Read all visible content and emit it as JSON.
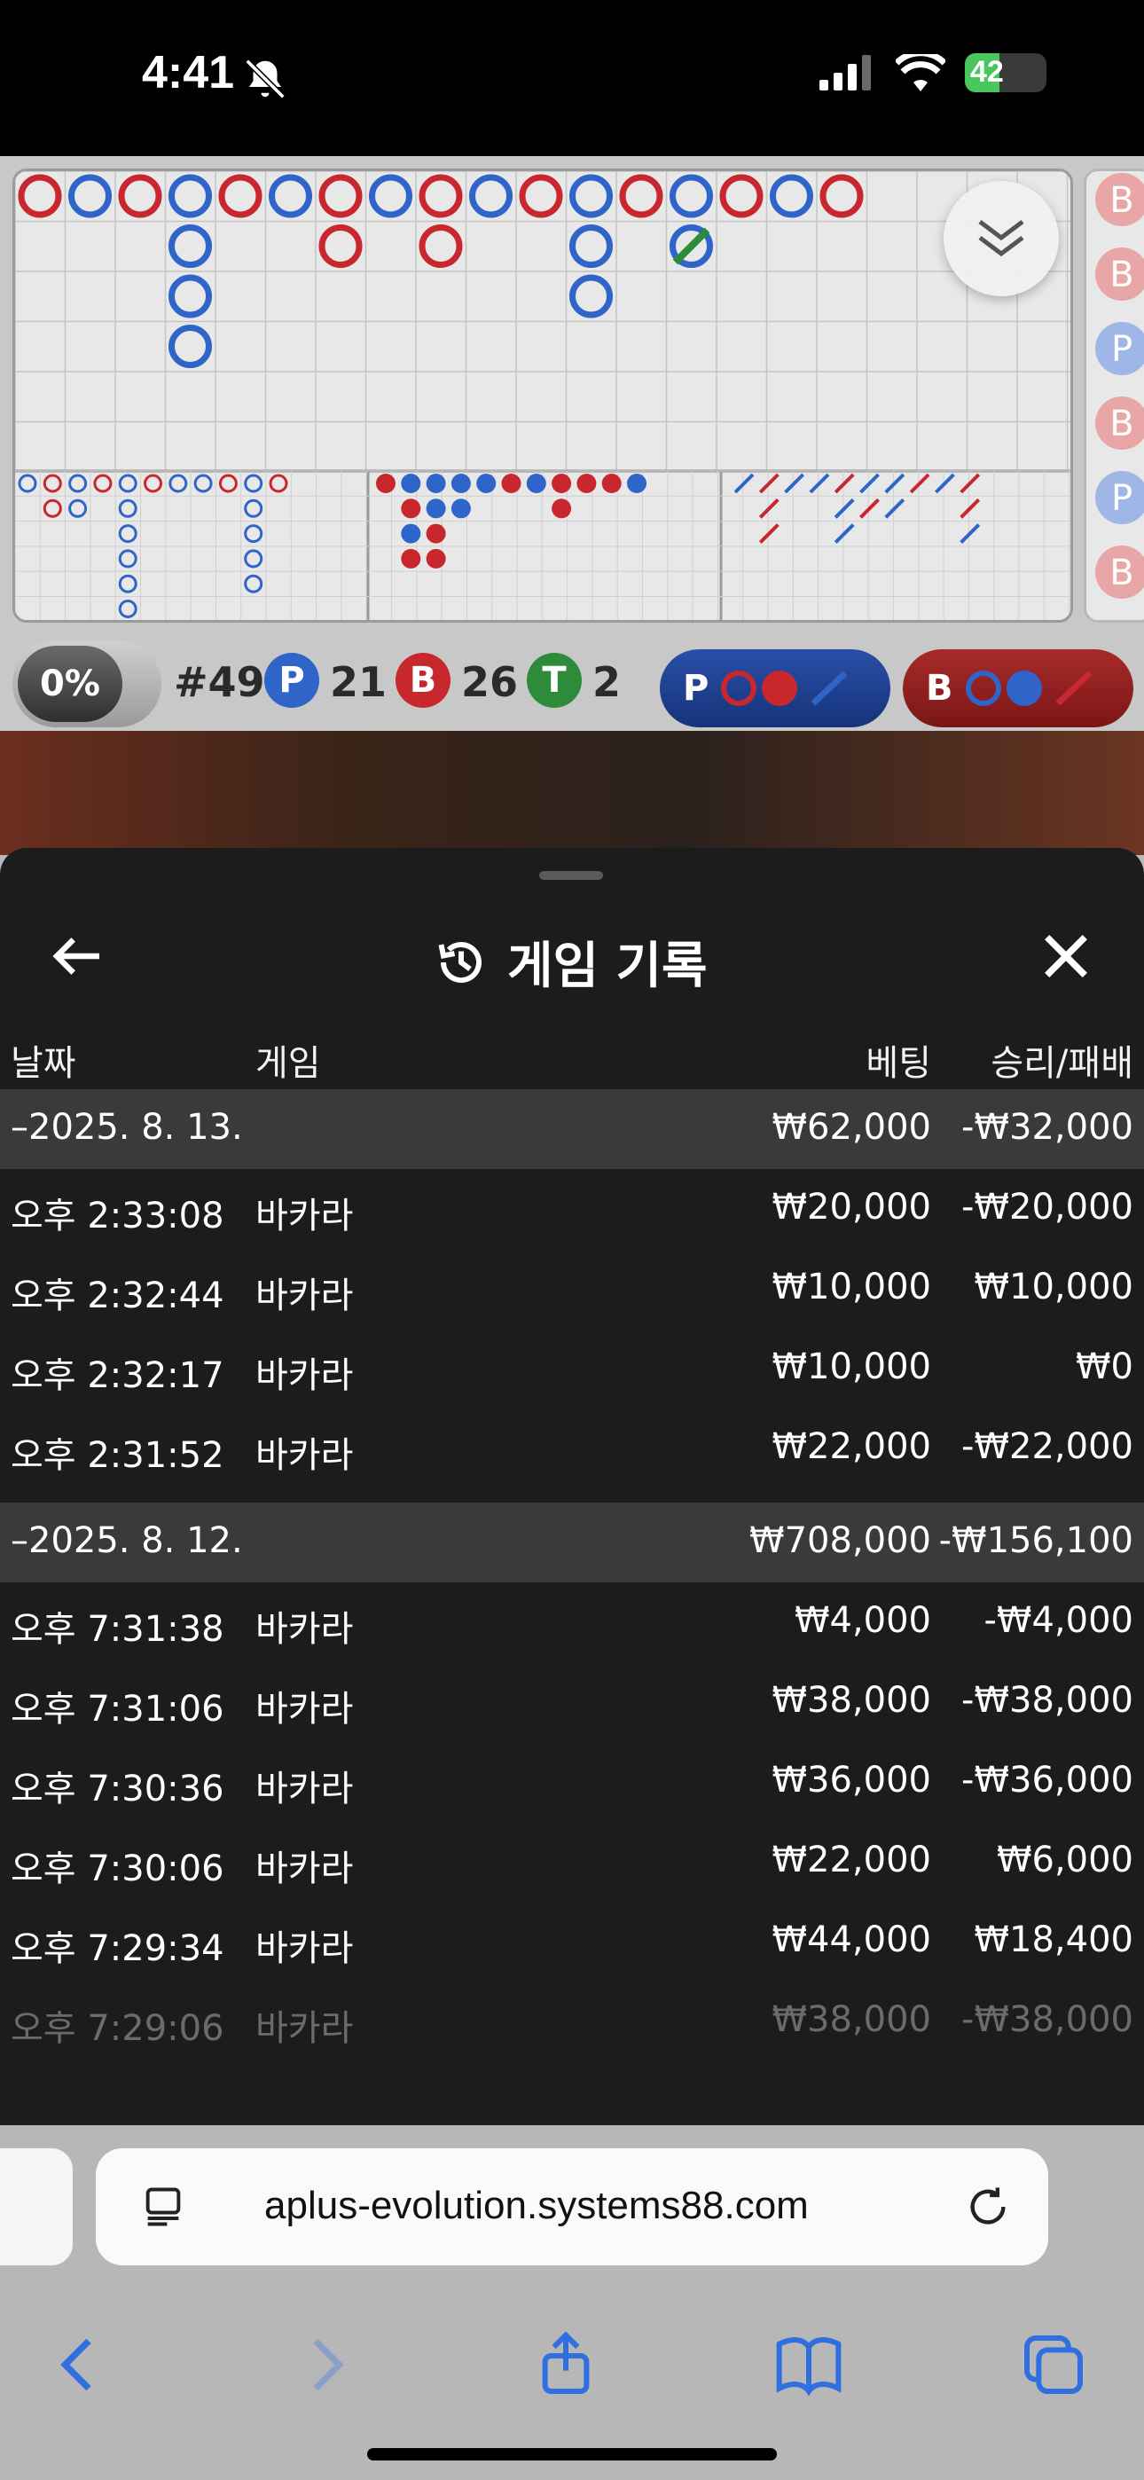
{
  "status_bar": {
    "time": "4:41",
    "battery": "42"
  },
  "roadmap": {
    "stats": {
      "percent": "0%",
      "round": "#49",
      "player_label": "P",
      "player_count": "21",
      "banker_label": "B",
      "banker_count": "26",
      "tie_label": "T",
      "tie_count": "2"
    },
    "predict_player_label": "P",
    "predict_banker_label": "B",
    "side_labels": [
      "B",
      "B",
      "P",
      "B",
      "P",
      "B"
    ],
    "colors": {
      "player": "#2f64c8",
      "banker": "#c8282d",
      "tie": "#2e8b3a"
    }
  },
  "history": {
    "title": "게임 기록",
    "columns": {
      "date": "날짜",
      "game": "게임",
      "bet": "베팅",
      "winloss": "승리/패배"
    },
    "groups": [
      {
        "date": "–2025. 8. 13.",
        "bet": "₩62,000",
        "winloss": "-₩32,000",
        "rows": [
          {
            "time": "오후 2:33:08",
            "game": "바카라",
            "bet": "₩20,000",
            "winloss": "-₩20,000"
          },
          {
            "time": "오후 2:32:44",
            "game": "바카라",
            "bet": "₩10,000",
            "winloss": "₩10,000"
          },
          {
            "time": "오후 2:32:17",
            "game": "바카라",
            "bet": "₩10,000",
            "winloss": "₩0"
          },
          {
            "time": "오후 2:31:52",
            "game": "바카라",
            "bet": "₩22,000",
            "winloss": "-₩22,000"
          }
        ]
      },
      {
        "date": "–2025. 8. 12.",
        "bet": "₩708,000",
        "winloss": "-₩156,100",
        "rows": [
          {
            "time": "오후 7:31:38",
            "game": "바카라",
            "bet": "₩4,000",
            "winloss": "-₩4,000"
          },
          {
            "time": "오후 7:31:06",
            "game": "바카라",
            "bet": "₩38,000",
            "winloss": "-₩38,000"
          },
          {
            "time": "오후 7:30:36",
            "game": "바카라",
            "bet": "₩36,000",
            "winloss": "-₩36,000"
          },
          {
            "time": "오후 7:30:06",
            "game": "바카라",
            "bet": "₩22,000",
            "winloss": "₩6,000"
          },
          {
            "time": "오후 7:29:34",
            "game": "바카라",
            "bet": "₩44,000",
            "winloss": "₩18,400"
          },
          {
            "time": "오후 7:29:06",
            "game": "바카라",
            "bet": "₩38,000",
            "winloss": "-₩38,000"
          }
        ]
      }
    ]
  },
  "browser": {
    "url": "aplus-evolution.systems88.com"
  }
}
